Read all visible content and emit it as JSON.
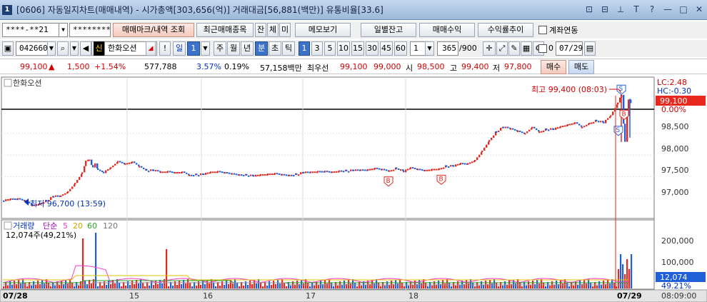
{
  "window": {
    "number": "1",
    "title": "[0606] 자동일지차트(매매내역) - 시가총액[303,656(억)] 거래대금[56,881(백만)] 유통비율[33.6]",
    "controls": [
      "⊡",
      "⊟",
      "⊥",
      "T",
      "?",
      "—",
      "□",
      "✕"
    ]
  },
  "toolbar1": {
    "account": "****-**21",
    "password": "********",
    "trade_marks_btn": "매매마크/내역 조회",
    "recent_btn": "최근매매종목",
    "btn_jan": "잔",
    "btn_che": "체",
    "btn_mi": "미",
    "memo_btn": "메모보기",
    "daily_balance_btn": "일별잔고",
    "trade_profit_btn": "매매수익",
    "profit_trend_btn": "수익률추이",
    "link_label": "계좌연동"
  },
  "toolbar2": {
    "code": "042660",
    "market_badge": "신",
    "stock_name": "한화오션",
    "period_day": "일",
    "period_num": "1",
    "periods": [
      "주",
      "월",
      "년",
      "분",
      "초",
      "틱"
    ],
    "active_period": "분",
    "minute_options": [
      "1",
      "3",
      "5",
      "10",
      "15",
      "30",
      "45",
      "60"
    ],
    "active_minute": "1",
    "custom_min": "1",
    "count": "365",
    "count_total": "/900",
    "zero_chk": "0",
    "date": "07/29"
  },
  "quote": {
    "price": "99,100",
    "arrow": "▲",
    "change": "1,500",
    "change_pct": "+1.54%",
    "volume": "577,788",
    "turnover_pct": "3.57%",
    "ratio": "0.19%",
    "amount": "57,158백만",
    "best_sell_label": "최우선",
    "best_sell": "99,100",
    "best_buy": "99,000",
    "open_label": "시",
    "open": "98,500",
    "high_label": "고",
    "high": "99,400",
    "low_label": "저",
    "low": "97,800",
    "buy_btn": "매수",
    "sell_btn": "매도"
  },
  "chart": {
    "stock_label": "한화오션",
    "high_annotation": "최고 99,400 (08:03)",
    "low_annotation": "최저 96,700 (13:59)",
    "lc_label": "LC:2.48",
    "hc_label": "HC:-0.30",
    "current_price_tag": "99,100",
    "current_pct_tag": "0.00%",
    "price_ticks": [
      "98,500",
      "98,000",
      "97,500",
      "97,000"
    ],
    "volume_legend": {
      "title": "거래량",
      "ma_label": "단순",
      "ma5": "5",
      "ma20": "20",
      "ma60": "60",
      "ma120": "120",
      "current": "12,074주(49,21%)"
    },
    "volume_ticks": [
      "200,000",
      "100,000"
    ],
    "volume_tag": "12,074",
    "volume_pct_tag": "49.21%",
    "x_labels": [
      "07/28",
      "15",
      "16",
      "17",
      "18",
      "07/29"
    ],
    "time_label": "08:09:00",
    "colors": {
      "up": "#e8281e",
      "down": "#1f5fd8",
      "ma5": "#ff3cc8",
      "ma20": "#e0c000",
      "ma60": "#2aa02a",
      "ma120": "#909090"
    }
  },
  "chart_data": {
    "type": "candlestick",
    "title": "한화오션",
    "ylim": [
      96600,
      99700
    ],
    "x_categories": [
      "07/28",
      "15",
      "16",
      "17",
      "18",
      "07/29"
    ],
    "series": [
      {
        "name": "price",
        "x": [
          0,
          10,
          20,
          30,
          40,
          50,
          60,
          70,
          80,
          90,
          100,
          110,
          115,
          120,
          125,
          128,
          132,
          140,
          150,
          160,
          170,
          180,
          190,
          200,
          210,
          220,
          230,
          240,
          250,
          260,
          270,
          280,
          290,
          300,
          310,
          320,
          330,
          340,
          350,
          360,
          370,
          380,
          390,
          400,
          410,
          420,
          430,
          440,
          450,
          460,
          470,
          480,
          490,
          500,
          510,
          520,
          530,
          540,
          550,
          560,
          570,
          580,
          590,
          600,
          610,
          620,
          630,
          640,
          650,
          660,
          670,
          680,
          690,
          700,
          710,
          720,
          730,
          740,
          750,
          760,
          770,
          780,
          790,
          800,
          810,
          820,
          830,
          840,
          850,
          860,
          865,
          870,
          875,
          880
        ],
        "y": [
          96950,
          96980,
          96990,
          96950,
          96850,
          96890,
          96950,
          97050,
          97050,
          97150,
          97350,
          97600,
          97850,
          97900,
          97700,
          97800,
          97650,
          97600,
          97700,
          97850,
          97800,
          97850,
          97750,
          97650,
          97650,
          97600,
          97620,
          97600,
          97620,
          97550,
          97550,
          97560,
          97600,
          97620,
          97600,
          97580,
          97560,
          97540,
          97520,
          97540,
          97560,
          97580,
          97560,
          97550,
          97560,
          97600,
          97600,
          97620,
          97630,
          97620,
          97650,
          97640,
          97650,
          97650,
          97660,
          97700,
          97680,
          97650,
          97700,
          97620,
          97700,
          97670,
          97650,
          97680,
          97700,
          97750,
          97750,
          97800,
          97800,
          97880,
          98100,
          98350,
          98550,
          98650,
          98600,
          98550,
          98500,
          98650,
          98550,
          98600,
          98600,
          98650,
          98700,
          98750,
          98650,
          98750,
          98800,
          98750,
          98900,
          99200,
          99400,
          98300,
          99300,
          99100
        ]
      }
    ]
  }
}
